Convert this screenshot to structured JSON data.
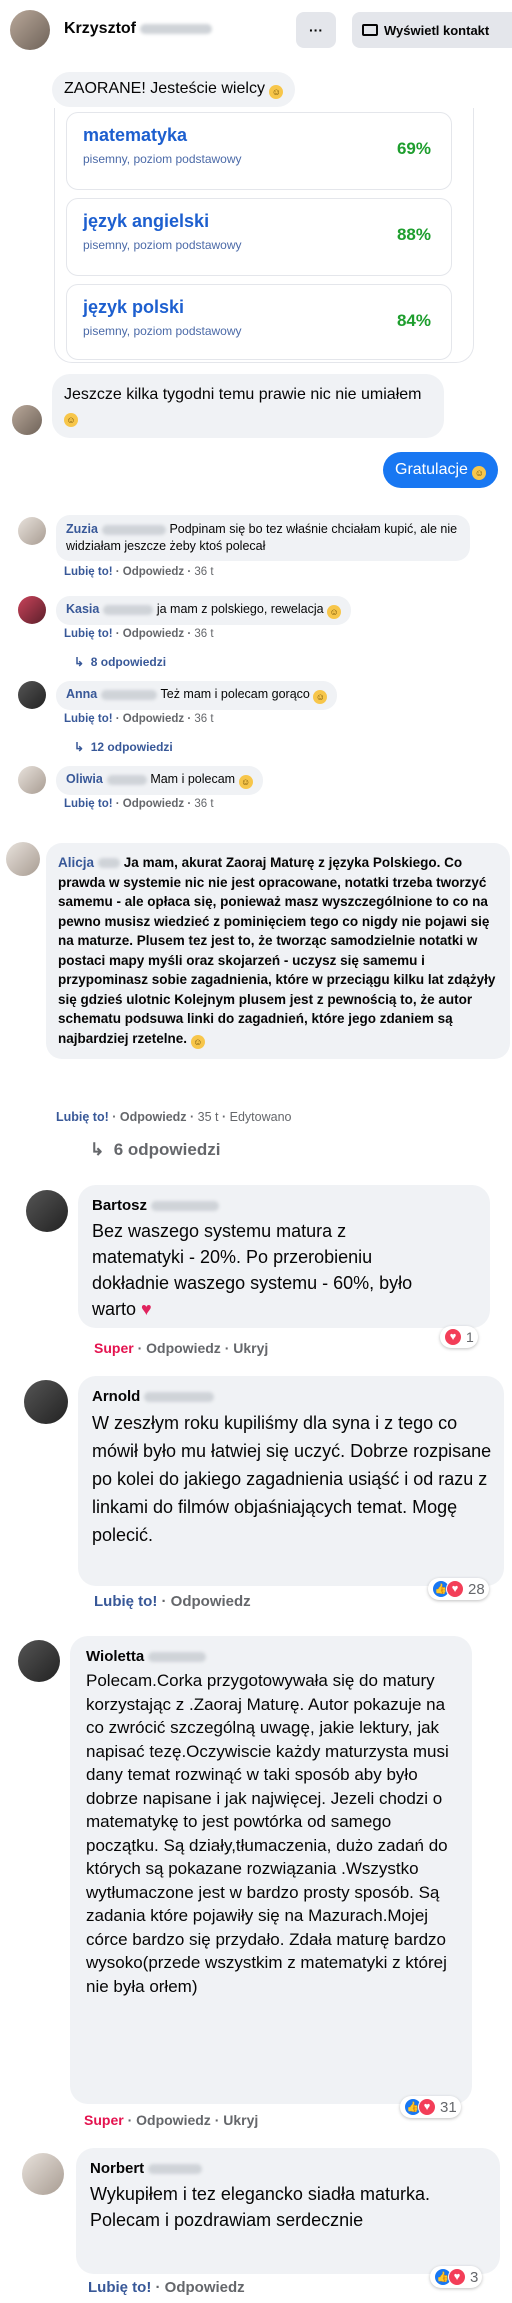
{
  "header": {
    "name": "Krzysztof",
    "more_label": "···",
    "contact_label": "Wyświetl kontakt"
  },
  "messenger": {
    "msg1": "ZAORANE! Jesteście wielcy",
    "grades": [
      {
        "subject": "matematyka",
        "detail": "pisemny, poziom podstawowy",
        "percent": "69%"
      },
      {
        "subject": "język angielski",
        "detail": "pisemny, poziom podstawowy",
        "percent": "88%"
      },
      {
        "subject": "język polski",
        "detail": "pisemny, poziom podstawowy",
        "percent": "84%"
      }
    ],
    "msg2": "Jeszcze kilka tygodni temu prawie nic nie umiałem",
    "reply": "Gratulacje"
  },
  "comments_small": [
    {
      "name": "Zuzia",
      "text": "Podpinam się bo tez właśnie chciałam kupić, ale nie widziałam jeszcze żeby ktoś polecał",
      "like": "Lubię to!",
      "reply": "Odpowiedz",
      "time": "36 t"
    },
    {
      "name": "Kasia",
      "text": "ja mam z polskiego, rewelacja",
      "like": "Lubię to!",
      "reply": "Odpowiedz",
      "time": "36 t",
      "replies": "8 odpowiedzi"
    },
    {
      "name": "Anna",
      "text": "Też mam i polecam gorąco",
      "like": "Lubię to!",
      "reply": "Odpowiedz",
      "time": "36 t",
      "replies": "12 odpowiedzi"
    },
    {
      "name": "Oliwia",
      "text": "Mam i polecam",
      "like": "Lubię to!",
      "reply": "Odpowiedz",
      "time": "36 t"
    }
  ],
  "alicja": {
    "name": "Alicja",
    "text": "Ja mam, akurat Zaoraj Maturę z języka Polskiego. Co prawda w systemie nic nie jest opracowane, notatki trzeba tworzyć samemu - ale opłaca się, ponieważ masz wyszczególnione to co na pewno musisz wiedzieć z pominięciem tego co nigdy nie pojawi się na maturze. Plusem tez jest to, że tworząc samodzielnie notatki w postaci mapy myśli oraz skojarzeń - uczysz się samemu i przypominasz sobie zagadnienia, które w przeciągu kilku lat zdążyły się gdzieś ulotnic Kolejnym plusem jest z pewnością to, że autor schematu podsuwa linki do zagadnień, które jego zdaniem są najbardziej rzetelne.",
    "like": "Lubię to!",
    "reply": "Odpowiedz",
    "time": "35 t",
    "edited": "Edytowano",
    "replies": "6 odpowiedzi"
  },
  "comments_large": [
    {
      "name": "Bartosz",
      "text": "Bez waszego systemu matura z matematyki - 20%. Po przerobieniu dokładnie waszego systemu - 60%, było warto",
      "action1": "Super",
      "reply": "Odpowiedz",
      "hide": "Ukryj",
      "count": "1"
    },
    {
      "name": "Arnold",
      "text": "W zeszłym roku kupiliśmy dla syna i z tego co mówił było mu łatwiej się uczyć. Dobrze rozpisane po kolei do jakiego zagadnienia usiąść i od razu z linkami do filmów objaśniających temat. Mogę polecić.",
      "action1": "Lubię to!",
      "reply": "Odpowiedz",
      "count": "28"
    },
    {
      "name": "Wioletta",
      "text": "Polecam.Corka przygotowywała się do matury korzystając z .Zaoraj Maturę. Autor pokazuje na co zwrócić szczególną uwagę, jakie lektury, jak napisać tezę.Oczywiscie każdy maturzysta musi dany temat rozwinąć w taki sposób aby było dobrze napisane i jak najwięcej. Jezeli chodzi o matematykę to jest powtórka od samego początku. Są działy,tłumaczenia, dużo zadań do których są pokazane rozwiązania .Wszystko wytłumaczone jest w bardzo prosty sposób. Są zadania które pojawiły się na Mazurach.Mojej córce bardzo się przydało. Zdała maturę bardzo wysoko(przede wszystkim z matematyki z której nie była orłem)",
      "action1": "Super",
      "reply": "Odpowiedz",
      "hide": "Ukryj",
      "count": "31"
    },
    {
      "name": "Norbert",
      "text": "Wykupiłem i tez elegancko siadła maturka. Polecam i pozdrawiam serdecznie",
      "action1": "Lubię to!",
      "reply": "Odpowiedz",
      "count": "3"
    }
  ],
  "colors": {
    "accent": "#1877f2",
    "link": "#385898",
    "super": "#e4134f",
    "percent": "#1e9e2e"
  }
}
